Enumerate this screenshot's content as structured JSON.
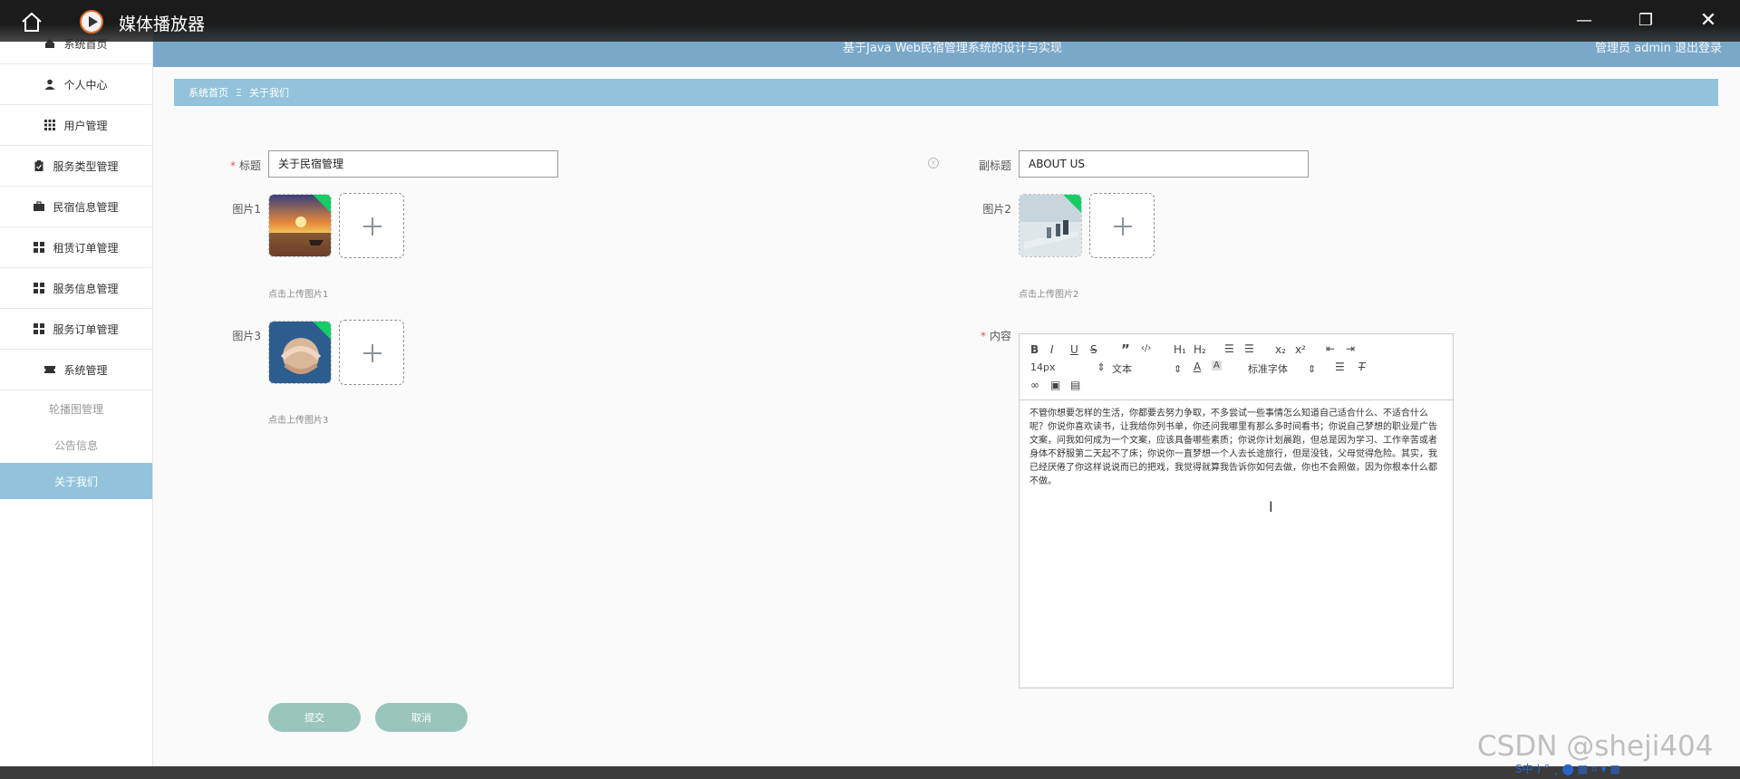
{
  "player": {
    "title": "媒体播放器",
    "min_glyph": "—",
    "max_glyph": "❐",
    "close_glyph": "✕"
  },
  "header": {
    "system_title": "基于Java Web民宿管理系统的设计与实现",
    "user_text": "管理员 admin  退出登录"
  },
  "sidebar": {
    "items": [
      {
        "label": "系统首页",
        "icon": "home-icon"
      },
      {
        "label": "个人中心",
        "icon": "user-icon"
      },
      {
        "label": "用户管理",
        "icon": "grid-icon"
      },
      {
        "label": "服务类型管理",
        "icon": "clipboard-icon"
      },
      {
        "label": "民宿信息管理",
        "icon": "briefcase-icon"
      },
      {
        "label": "租赁订单管理",
        "icon": "tiles-icon"
      },
      {
        "label": "服务信息管理",
        "icon": "tiles-icon"
      },
      {
        "label": "服务订单管理",
        "icon": "tiles-icon"
      },
      {
        "label": "系统管理",
        "icon": "ticket-icon"
      }
    ],
    "sub_items": [
      {
        "label": "轮播图管理"
      },
      {
        "label": "公告信息"
      },
      {
        "label": "关于我们"
      }
    ]
  },
  "breadcrumb": {
    "home": "系统首页",
    "sep": "Ξ",
    "current": "关于我们"
  },
  "form": {
    "title_label": "标题",
    "title_value": "关于民宿管理",
    "subtitle_label": "副标题",
    "subtitle_value": "ABOUT US",
    "pic1_label": "图片1",
    "pic1_hint": "点击上传图片1",
    "pic2_label": "图片2",
    "pic2_hint": "点击上传图片2",
    "pic3_label": "图片3",
    "pic3_hint": "点击上传图片3",
    "content_label": "内容",
    "submit_label": "提交",
    "cancel_label": "取消"
  },
  "editor": {
    "font_size": "14px",
    "block_format": "文本",
    "font_family": "标准字体",
    "content": "不管你想要怎样的生活，你都要去努力争取，不多尝试一些事情怎么知道自己适合什么、不适合什么呢？你说你喜欢读书，让我给你列书单，你还问我哪里有那么多时间看书；你说自己梦想的职业是广告文案，问我如何成为一个文案，应该具备哪些素质；你说你计划晨跑，但总是因为学习、工作辛苦或者身体不舒服第二天起不了床；你说你一直梦想一个人去长途旅行，但是没钱，父母觉得危险。其实，我已经厌倦了你这样说说而已的把戏，我觉得就算我告诉你如何去做，你也不会照做，因为你根本什么都不做。"
  },
  "watermark": "CSDN @sheji404",
  "tray": "S中 ) ° ¸ ⬤ ▦ ⌗ ▾ ▦"
}
